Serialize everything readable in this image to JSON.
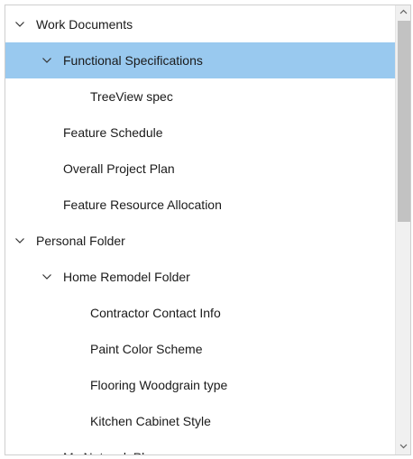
{
  "tree": {
    "items": [
      {
        "label": "Work Documents",
        "level": 0,
        "expanded": true,
        "selected": false
      },
      {
        "label": "Functional Specifications",
        "level": 1,
        "expanded": true,
        "selected": true
      },
      {
        "label": "TreeView spec",
        "level": 2,
        "expanded": null,
        "selected": false
      },
      {
        "label": "Feature Schedule",
        "level": 1,
        "expanded": null,
        "selected": false
      },
      {
        "label": "Overall Project Plan",
        "level": 1,
        "expanded": null,
        "selected": false
      },
      {
        "label": "Feature Resource Allocation",
        "level": 1,
        "expanded": null,
        "selected": false
      },
      {
        "label": "Personal Folder",
        "level": 0,
        "expanded": true,
        "selected": false
      },
      {
        "label": "Home Remodel Folder",
        "level": 1,
        "expanded": true,
        "selected": false
      },
      {
        "label": "Contractor Contact Info",
        "level": 2,
        "expanded": null,
        "selected": false
      },
      {
        "label": "Paint Color Scheme",
        "level": 2,
        "expanded": null,
        "selected": false
      },
      {
        "label": "Flooring Woodgrain type",
        "level": 2,
        "expanded": null,
        "selected": false
      },
      {
        "label": "Kitchen Cabinet Style",
        "level": 2,
        "expanded": null,
        "selected": false
      },
      {
        "label": "My Network Places",
        "level": 1,
        "expanded": true,
        "selected": false
      }
    ]
  },
  "colors": {
    "selection": "#99c9ef",
    "scroll_thumb": "#c2c2c2",
    "scroll_track": "#f0f0f0"
  },
  "icons": {
    "expanded": "chevron-down-icon",
    "scroll_up": "scroll-up-arrow-icon",
    "scroll_down": "scroll-down-arrow-icon"
  },
  "scroll": {
    "position_fraction": 0.0,
    "visible_fraction": 0.46
  }
}
